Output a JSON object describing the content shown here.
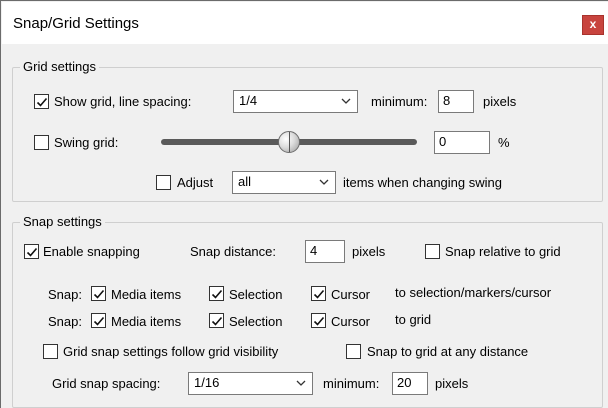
{
  "window": {
    "title": "Snap/Grid Settings",
    "close_label": "x"
  },
  "grid_settings": {
    "label": "Grid settings",
    "show_grid": {
      "label": "Show grid, line spacing:",
      "checked": true,
      "spacing_value": "1/4",
      "minimum_label": "minimum:",
      "minimum_value": "8",
      "unit": "pixels"
    },
    "swing_grid": {
      "label": "Swing grid:",
      "checked": false,
      "slider_level": 0.5,
      "value": "0",
      "unit": "%"
    },
    "adjust": {
      "label": "Adjust",
      "checked": false,
      "selected": "all",
      "suffix": "items when changing swing"
    }
  },
  "snap_settings": {
    "label": "Snap settings",
    "enable_snapping": {
      "label": "Enable snapping",
      "checked": true
    },
    "snap_distance": {
      "label": "Snap distance:",
      "value": "4",
      "unit": "pixels"
    },
    "snap_relative": {
      "label": "Snap relative to grid",
      "checked": false
    },
    "row1": {
      "prefix": "Snap:",
      "media": "Media items",
      "selection": "Selection",
      "cursor": "Cursor",
      "suffix": "to selection/markers/cursor"
    },
    "row2": {
      "prefix": "Snap:",
      "media": "Media items",
      "selection": "Selection",
      "cursor": "Cursor",
      "suffix": "to grid"
    },
    "follow_visibility": {
      "label": "Grid snap settings follow grid visibility",
      "checked": false
    },
    "any_distance": {
      "label": "Snap to grid at any distance",
      "checked": false
    },
    "spacing": {
      "label": "Grid snap spacing:",
      "value": "1/16",
      "minimum_label": "minimum:",
      "minimum_value": "20",
      "unit": "pixels"
    }
  },
  "colors": {
    "close_button": "#c8443e",
    "background": "#f0f0f0",
    "slider_track": "#5a5a5a"
  },
  "icons": {
    "check": "checkmark-icon",
    "dropdown": "chevron-down-icon",
    "close": "close-icon"
  }
}
